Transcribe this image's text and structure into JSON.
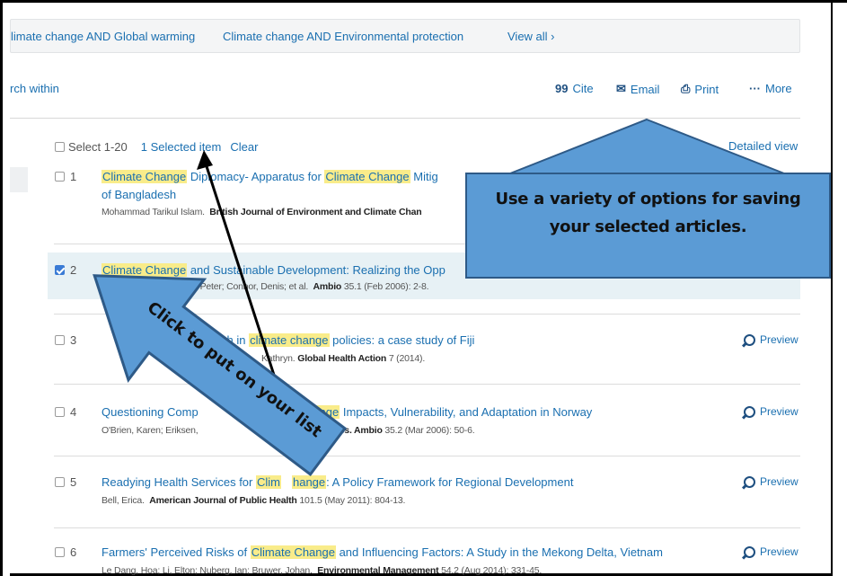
{
  "related_searches": {
    "items": [
      "limate change AND Global warming",
      "Climate change AND Environmental protection"
    ],
    "view_all": "View all ›"
  },
  "search_within": "rch within",
  "actions": {
    "cite": {
      "icon": "quote-icon",
      "glyph": "99",
      "label": "Cite"
    },
    "email": {
      "icon": "envelope-icon",
      "glyph": "✉",
      "label": "Email"
    },
    "print": {
      "icon": "printer-icon",
      "glyph": "⎙",
      "label": "Print"
    },
    "more": {
      "icon": "ellipsis-icon",
      "glyph": "···",
      "label": "More"
    }
  },
  "selection": {
    "select_label": "Select 1-20",
    "selected_count": "1 Selected item",
    "clear": "Clear",
    "detailed_view": "Detailed view"
  },
  "results": [
    {
      "num": "1",
      "checked": false,
      "title_line1": [
        "Climate Change",
        " Diplomacy- Apparatus for ",
        "Climate Change",
        " Mitig"
      ],
      "title_line2": "of Bangladesh",
      "meta_authors": "Mohammad Tarikul Islam.",
      "meta_source": "British Journal of Environment and Climate Chan",
      "meta_rest": "",
      "preview": ""
    },
    {
      "num": "2",
      "checked": true,
      "title_line1": [
        "Climate Change",
        " and Sustainable Development: Realizing the Opp",
        "",
        ""
      ],
      "title_line2": "",
      "meta_authors": "n; Bradley, Mike; Busby, Peter; Connor, Denis; et al.",
      "meta_source": "Ambio",
      "meta_rest": "35.1  (Feb 2006): 2-8.",
      "preview": ""
    },
    {
      "num": "3",
      "checked": false,
      "title_line1": [
        "",
        "lth in ",
        "climate change",
        " policies: a case study of Fiji"
      ],
      "title_line2": "",
      "meta_authors": "Kathryn.",
      "meta_source": "Global Health Action",
      "meta_rest": "7  (2014).",
      "preview": "Preview"
    },
    {
      "num": "4",
      "checked": false,
      "title_line1": [
        "Questioning Comp",
        "",
        "Change",
        " Impacts, Vulnerability, and Adaptation in Norway"
      ],
      "title_line2": "",
      "meta_authors": "O'Brien, Karen; Eriksen,",
      "meta_source": "Otto Naess.  Ambio",
      "meta_rest": "35.2  (Mar 2006): 50-6.",
      "preview": "Preview"
    },
    {
      "num": "5",
      "checked": false,
      "title_line1": [
        "Readying Health Services for ",
        "Clim",
        "hange",
        ": A Policy Framework for Regional Development"
      ],
      "title_line2": "",
      "meta_authors": "Bell, Erica.",
      "meta_source": "American Journal of Public Health",
      "meta_rest": "101.5  (May 2011): 804-13.",
      "preview": "Preview"
    },
    {
      "num": "6",
      "checked": false,
      "title_line1": [
        "Farmers' Perceived Risks of ",
        "Climate Change",
        " and Influencing Factors: A Study in the Mekong Delta, Vietnam",
        ""
      ],
      "title_line2": "",
      "meta_authors": "Le Dang, Hoa; Li, Elton; Nuberg, Ian; Bruwer, Johan.",
      "meta_source": "Environmental Management",
      "meta_rest": "54.2  (Aug 2014): 331-45.",
      "preview": "Preview"
    }
  ],
  "annotations": {
    "callout_line1": "Use a variety of options for saving",
    "callout_line2": "your selected articles.",
    "arrow_label": "Click to put on your list",
    "arrow_color": "#5b9bd5",
    "arrow_border": "#2e5a87"
  },
  "colors": {
    "link": "#1a6fb0",
    "highlight": "#f9ec8a",
    "selected_row": "#e7f1f5"
  }
}
